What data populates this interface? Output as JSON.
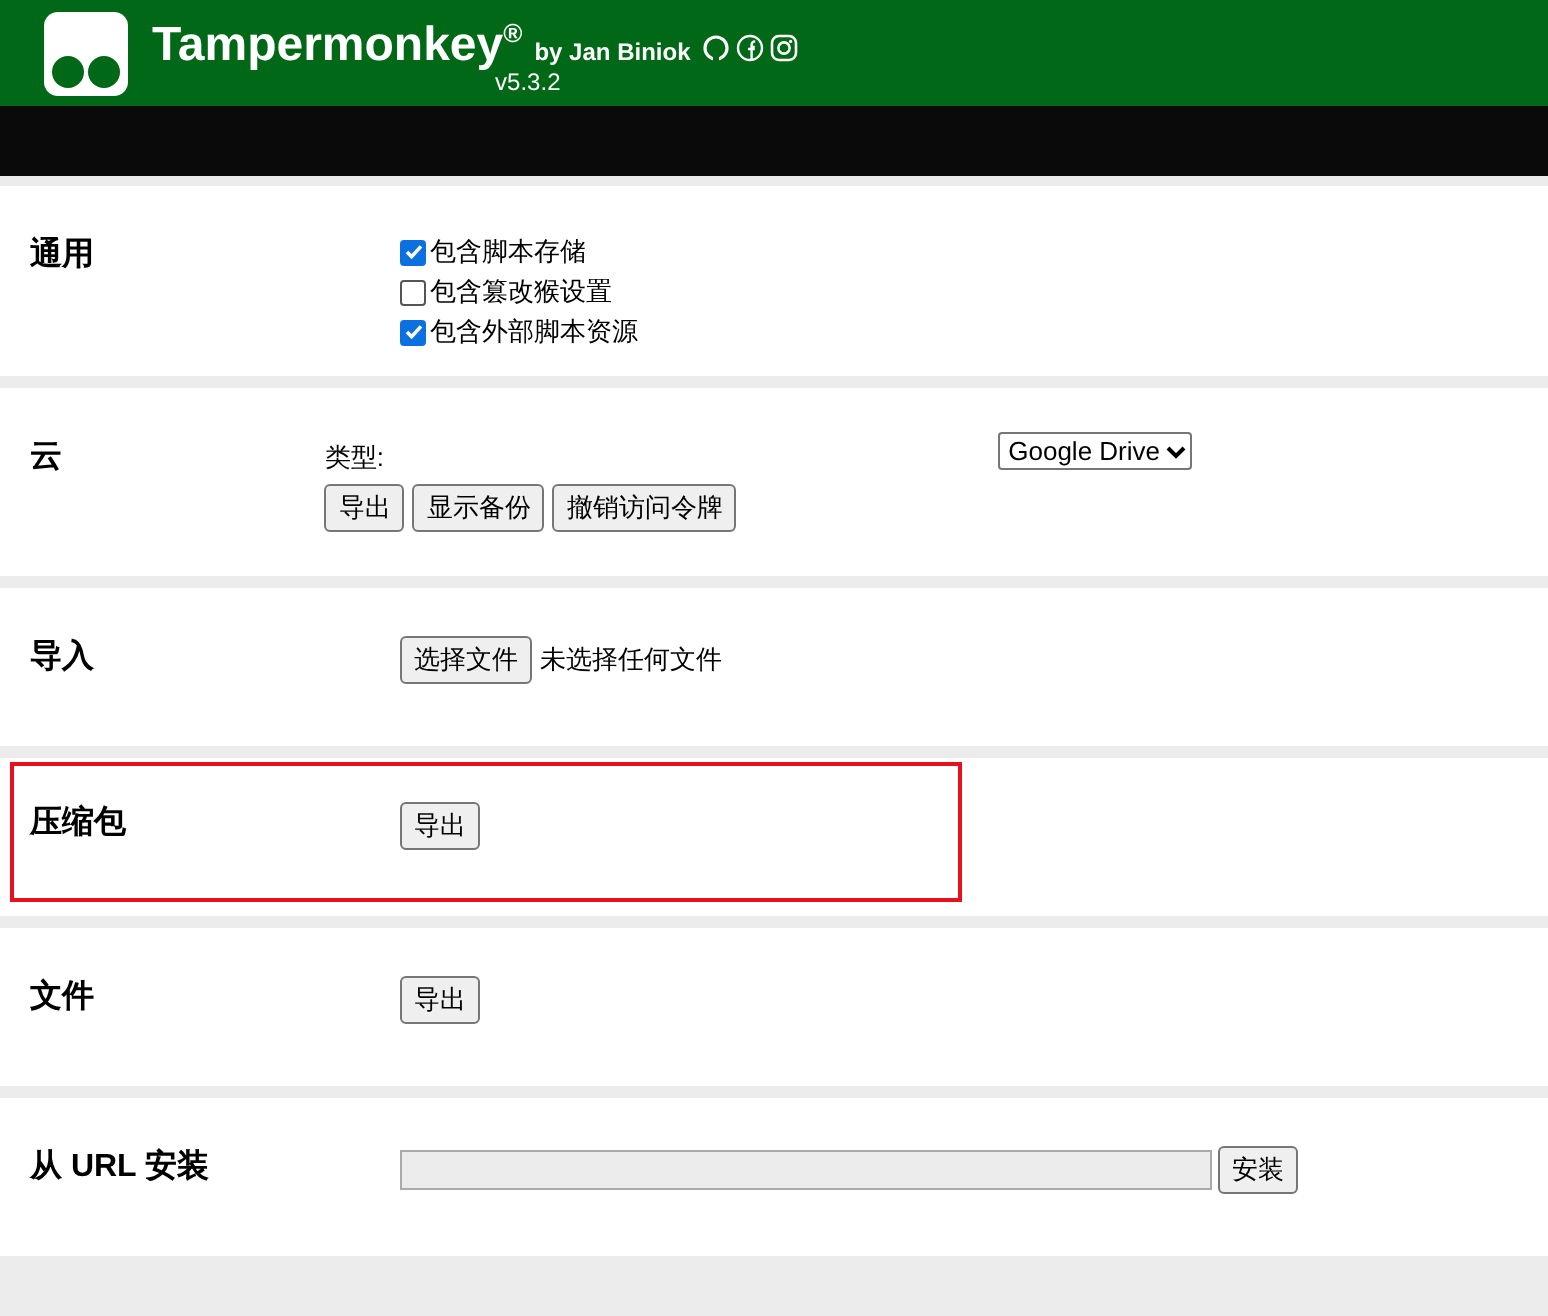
{
  "header": {
    "title": "Tampermonkey",
    "title_mark": "®",
    "author": "by Jan Biniok",
    "version": "v5.3.2"
  },
  "sections": [
    {
      "kind": "checkboxes",
      "label": "通用",
      "highlighted": false,
      "options": [
        {
          "label": "包含脚本存储",
          "checked": true
        },
        {
          "label": "包含篡改猴设置",
          "checked": false
        },
        {
          "label": "包含外部脚本资源",
          "checked": true
        }
      ]
    },
    {
      "kind": "cloud",
      "label": "云",
      "highlighted": false,
      "type_label": "类型:",
      "select_value": "Google Drive",
      "buttons": [
        "导出",
        "显示备份",
        "撤销访问令牌"
      ]
    },
    {
      "kind": "file",
      "label": "导入",
      "highlighted": false,
      "button": "选择文件",
      "status": "未选择任何文件"
    },
    {
      "kind": "export",
      "label": "压缩包",
      "highlighted": true,
      "button": "导出"
    },
    {
      "kind": "export",
      "label": "文件",
      "highlighted": false,
      "button": "导出"
    },
    {
      "kind": "url",
      "label": "从 URL 安装",
      "highlighted": false,
      "button": "安装"
    }
  ]
}
